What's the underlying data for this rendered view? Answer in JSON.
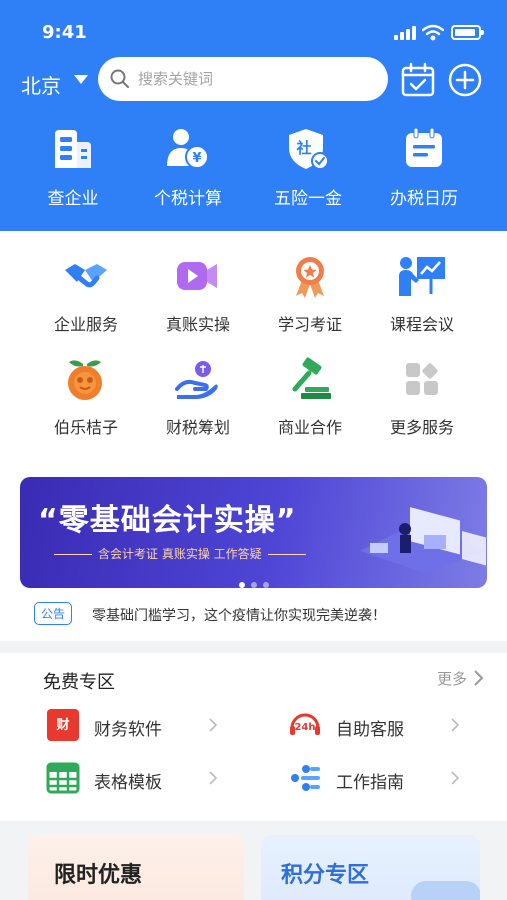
{
  "status_bar": {
    "time": "9:41"
  },
  "header": {
    "city": "北京",
    "search_placeholder": "搜索关键词",
    "quick_actions": [
      {
        "label": "查企业",
        "icon": "building-icon"
      },
      {
        "label": "个税计算",
        "icon": "tax-person-icon"
      },
      {
        "label": "五险一金",
        "icon": "social-insurance-shield-icon"
      },
      {
        "label": "办税日历",
        "icon": "tax-calendar-icon"
      }
    ]
  },
  "services": [
    {
      "label": "企业服务",
      "icon": "handshake-icon"
    },
    {
      "label": "真账实操",
      "icon": "video-icon"
    },
    {
      "label": "学习考证",
      "icon": "award-medal-icon"
    },
    {
      "label": "课程会议",
      "icon": "presentation-icon"
    },
    {
      "label": "伯乐桔子",
      "icon": "orange-icon"
    },
    {
      "label": "财税筹划",
      "icon": "hand-coin-icon"
    },
    {
      "label": "商业合作",
      "icon": "gavel-icon"
    },
    {
      "label": "更多服务",
      "icon": "more-grid-icon"
    }
  ],
  "banner": {
    "title": "“零基础会计实操”",
    "subtitle": "含会计考证  真账实操  工作答疑",
    "active_slide": 1,
    "slide_count": 3
  },
  "notice": {
    "tag": "公告",
    "text": "零基础门槛学习，这个疫情让你实现完美逆袭！"
  },
  "free_zone": {
    "title": "免费专区",
    "more": "更多",
    "items": [
      {
        "label": "财务软件",
        "icon": "finance-software-icon"
      },
      {
        "label": "自助客服",
        "icon": "support-24h-icon"
      },
      {
        "label": "表格模板",
        "icon": "spreadsheet-icon"
      },
      {
        "label": "工作指南",
        "icon": "guide-icon"
      }
    ]
  },
  "promos": [
    {
      "title": "限时优惠"
    },
    {
      "title": "积分专区"
    }
  ],
  "colors": {
    "primary": "#2f7ff6",
    "background": "#f2f3f5"
  }
}
